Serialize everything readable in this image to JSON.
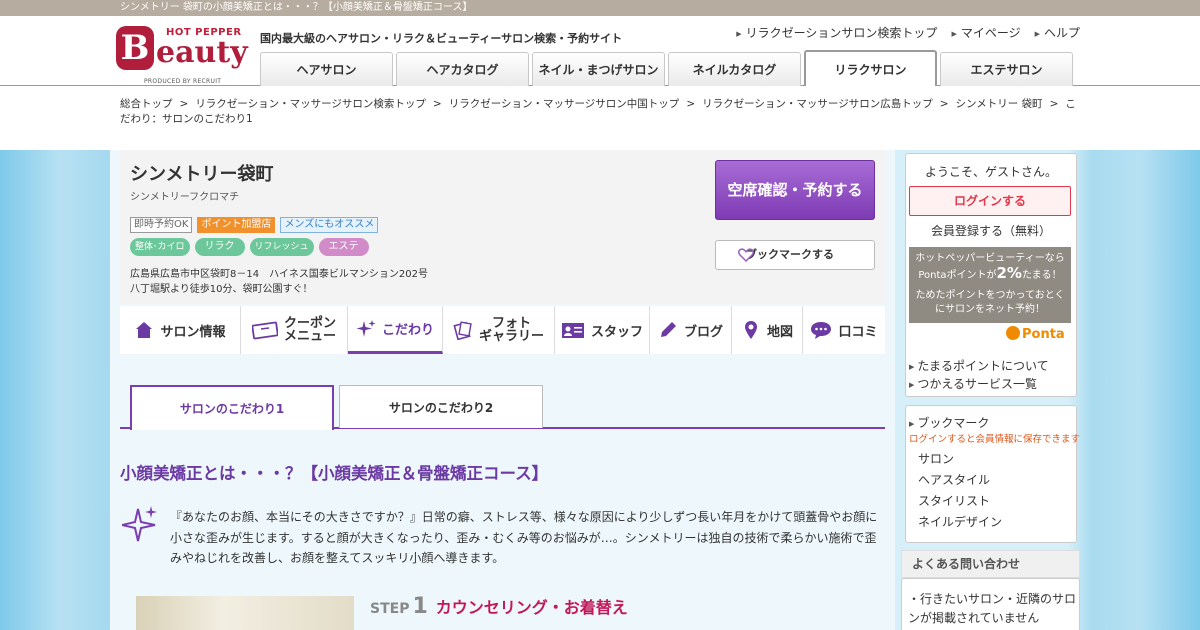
{
  "page_title_bar": "シンメトリー 袋町の小顔美矯正とは・・・？【小顔美矯正＆骨盤矯正コース】",
  "logo": {
    "hot_pepper": "HOT PEPPER",
    "brand": "Beauty",
    "produced_by": "PRODUCED BY RECRUIT"
  },
  "header": {
    "tagline": "国内最大級のヘアサロン・リラク＆ビューティーサロン検索・予約サイト",
    "links": [
      "リラクゼーションサロン検索トップ",
      "マイページ",
      "ヘルプ"
    ],
    "tabs": [
      "ヘアサロン",
      "ヘアカタログ",
      "ネイル・まつげサロン",
      "ネイルカタログ",
      "リラクサロン",
      "エステサロン"
    ]
  },
  "breadcrumb": [
    "総合トップ",
    "リラクゼーション・マッサージサロン検索トップ",
    "リラクゼーション・マッサージサロン中国トップ",
    "リラクゼーション・マッサージサロン広島トップ",
    "シンメトリー 袋町",
    "こだわり：サロンのこだわり1"
  ],
  "breadcrumb_sep": ">",
  "shop": {
    "name": "シンメトリー袋町",
    "kana": "シンメトリーフクロマチ",
    "badges": [
      "即時予約OK",
      "ポイント加盟店",
      "メンズにもオススメ"
    ],
    "categories": [
      {
        "label": "整体･カイロ",
        "color": "#6cc79a"
      },
      {
        "label": "リラク",
        "color": "#6cc79a"
      },
      {
        "label": "リフレッシュ",
        "color": "#6cc79a"
      },
      {
        "label": "エステ",
        "color": "#d08bc8"
      }
    ],
    "address": "広島県広島市中区袋町8－14　ハイネス国泰ビルマンション202号",
    "access": "八丁堀駅より徒歩10分、袋町公園すぐ！",
    "reserve_button": "空席確認・予約する",
    "bookmark_button": "ブックマークする"
  },
  "salon_nav": [
    {
      "label": "サロン情報",
      "icon": "house-icon"
    },
    {
      "label": "クーポン",
      "label2": "メニュー",
      "icon": "ticket-icon"
    },
    {
      "label": "こだわり",
      "icon": "sparkle-icon",
      "active": true
    },
    {
      "label": "フォト",
      "label2": "ギャラリー",
      "icon": "photo-icon"
    },
    {
      "label": "スタッフ",
      "icon": "id-card-icon"
    },
    {
      "label": "ブログ",
      "icon": "pen-icon"
    },
    {
      "label": "地図",
      "icon": "map-pin-icon"
    },
    {
      "label": "口コミ",
      "icon": "speech-bubble-icon"
    }
  ],
  "subtabs": [
    "サロンのこだわり1",
    "サロンのこだわり2"
  ],
  "content": {
    "title": "小顔美矯正とは・・・？【小顔美矯正＆骨盤矯正コース】",
    "intro": "『あなたのお顔、本当にその大きさですか？』日常の癖、ストレス等、様々な原因により少しずつ長い年月をかけて頭蓋骨やお顔に小さな歪みが生じます。すると顔が大きくなったり、歪み・むくみ等のお悩みが…。シンメトリーは独自の技術で柔らかい施術で歪みやねじれを改善し、お顔を整えてスッキリ小顔へ導きます。",
    "step": {
      "prefix": "STEP",
      "number": "1",
      "title": "カウンセリング・お着替え"
    }
  },
  "sidebar": {
    "welcome": "ようこそ、ゲストさん。",
    "login": "ログインする",
    "signup": "会員登録する（無料）",
    "ponta_line1": "ホットペッパービューティーなら",
    "ponta_line2_pre": "Pontaポイントが",
    "ponta_pct": "2%",
    "ponta_line2_post": "たまる！",
    "ponta_line3": "ためたポイントをつかっておとく",
    "ponta_line4": "にサロンをネット予約！",
    "ponta_logo": "Ponta",
    "point_links": [
      "たまるポイントについて",
      "つかえるサービス一覧"
    ],
    "bookmark_title": "ブックマーク",
    "bookmark_note": "ログインすると会員情報に保存できます",
    "bookmark_items": [
      "サロン",
      "ヘアスタイル",
      "スタイリスト",
      "ネイルデザイン"
    ],
    "faq_title": "よくある問い合わせ",
    "faq_item": "・行きたいサロン・近隣のサロンが掲載されていません"
  }
}
